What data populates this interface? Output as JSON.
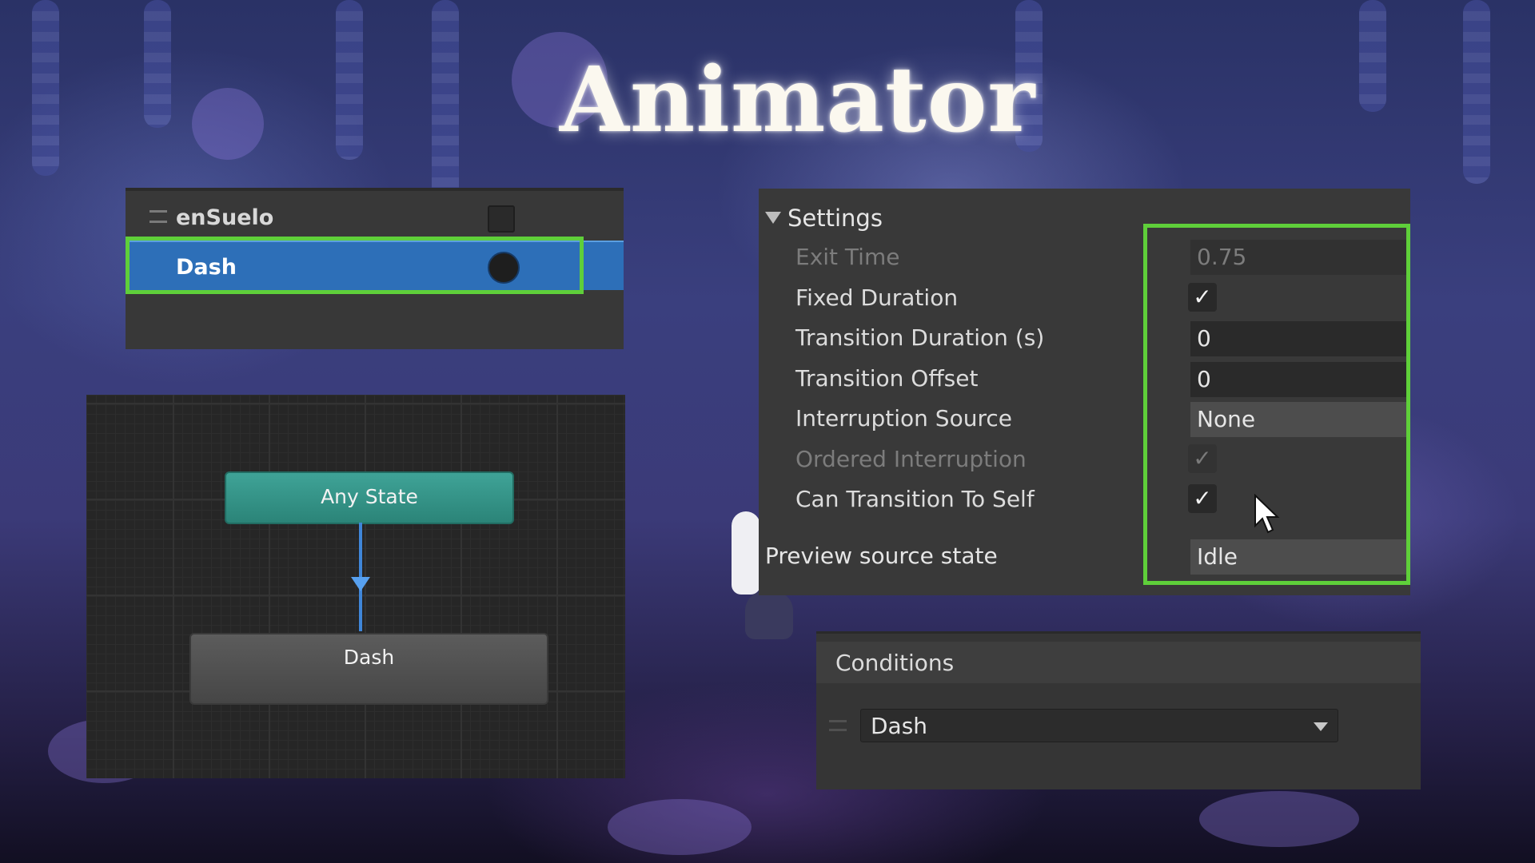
{
  "title": "Animator",
  "parameters": {
    "items": [
      {
        "name": "enSuelo",
        "type": "bool",
        "selected": false
      },
      {
        "name": "Dash",
        "type": "trigger",
        "selected": true
      }
    ]
  },
  "graph": {
    "any_state_label": "Any State",
    "dash_state_label": "Dash"
  },
  "settings": {
    "header": "Settings",
    "exit_time_label": "Exit Time",
    "exit_time_value": "0.75",
    "fixed_duration_label": "Fixed Duration",
    "fixed_duration_checked": true,
    "transition_duration_label": "Transition Duration (s)",
    "transition_duration_value": "0",
    "transition_offset_label": "Transition Offset",
    "transition_offset_value": "0",
    "interruption_source_label": "Interruption Source",
    "interruption_source_value": "None",
    "ordered_interruption_label": "Ordered Interruption",
    "ordered_interruption_checked": true,
    "can_transition_to_self_label": "Can Transition To Self",
    "can_transition_to_self_checked": true,
    "preview_source_label": "Preview source state",
    "preview_source_value": "Idle",
    "check_glyph": "✓"
  },
  "conditions": {
    "title": "Conditions",
    "items": [
      {
        "parameter": "Dash"
      }
    ]
  },
  "colors": {
    "highlight": "#5fcf3a",
    "selected_row": "#2d6fb8",
    "any_state_node": "#3fa397",
    "transition_arrow": "#3f86d9"
  }
}
